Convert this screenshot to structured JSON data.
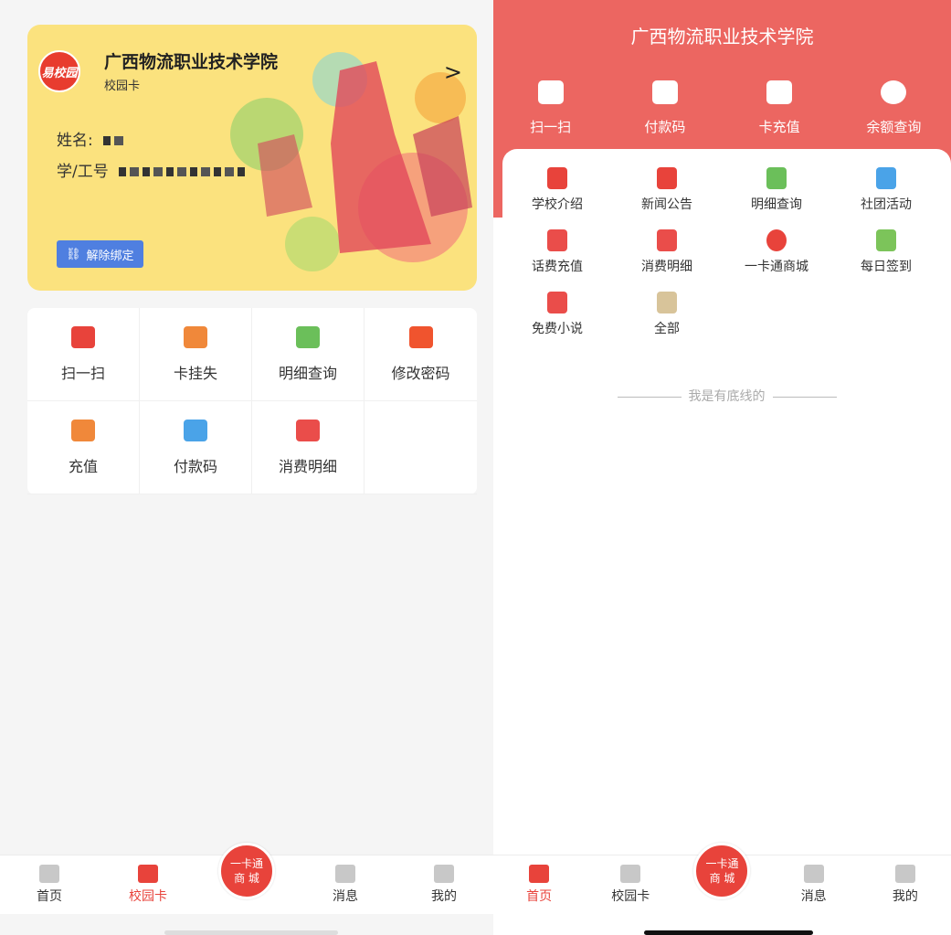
{
  "left": {
    "card": {
      "logo_text": "易校园",
      "school": "广西物流职业技术学院",
      "subtitle": "校园卡",
      "arrow": ">",
      "name_label": "姓名:",
      "id_label": "学/工号",
      "unbind_label": "解除绑定"
    },
    "grid": [
      {
        "label": "扫一扫",
        "icon": "scan-icon",
        "color": "#e8433b"
      },
      {
        "label": "卡挂失",
        "icon": "card-lost-icon",
        "color": "#f0883a"
      },
      {
        "label": "明细查询",
        "icon": "detail-query-icon",
        "color": "#6bbf5a"
      },
      {
        "label": "修改密码",
        "icon": "lock-icon",
        "color": "#f0542e"
      },
      {
        "label": "充值",
        "icon": "recharge-icon",
        "color": "#f0883a"
      },
      {
        "label": "付款码",
        "icon": "qr-code-icon",
        "color": "#4aa3e8"
      },
      {
        "label": "消费明细",
        "icon": "consumption-list-icon",
        "color": "#ea4d4a"
      }
    ],
    "nav": [
      {
        "label": "首页",
        "icon": "home-icon"
      },
      {
        "label": "校园卡",
        "icon": "card-icon"
      },
      {
        "label": "商 城",
        "top": "一卡通",
        "icon": "mall-icon"
      },
      {
        "label": "消息",
        "icon": "message-icon"
      },
      {
        "label": "我的",
        "icon": "user-icon"
      }
    ]
  },
  "right": {
    "title": "广西物流职业技术学院",
    "top": [
      {
        "label": "扫一扫",
        "icon": "scan-icon"
      },
      {
        "label": "付款码",
        "icon": "qr-code-icon"
      },
      {
        "label": "卡充值",
        "icon": "card-recharge-icon"
      },
      {
        "label": "余额查询",
        "icon": "money-bag-icon"
      }
    ],
    "grid": [
      {
        "label": "学校介绍",
        "icon": "school-icon",
        "color": "#e8433b"
      },
      {
        "label": "新闻公告",
        "icon": "news-icon",
        "color": "#e8433b"
      },
      {
        "label": "明细查询",
        "icon": "detail-query-icon",
        "color": "#6bbf5a"
      },
      {
        "label": "社团活动",
        "icon": "flag-icon",
        "color": "#4aa3e8"
      },
      {
        "label": "话费充值",
        "icon": "phone-recharge-icon",
        "color": "#ea4d4a"
      },
      {
        "label": "消费明细",
        "icon": "consumption-list-icon",
        "color": "#ea4d4a"
      },
      {
        "label": "一卡通商城",
        "icon": "heart-hand-icon",
        "color": "#e8433b"
      },
      {
        "label": "每日签到",
        "icon": "calendar-check-icon",
        "color": "#7cc45a"
      },
      {
        "label": "免费小说",
        "icon": "book-icon",
        "color": "#ea4d4a"
      },
      {
        "label": "全部",
        "icon": "all-grid-icon",
        "color": "#d8c49a"
      }
    ],
    "bottom_line": "我是有底线的",
    "nav": [
      {
        "label": "首页",
        "icon": "home-icon"
      },
      {
        "label": "校园卡",
        "icon": "card-icon"
      },
      {
        "label": "商 城",
        "top": "一卡通",
        "icon": "mall-icon"
      },
      {
        "label": "消息",
        "icon": "message-icon"
      },
      {
        "label": "我的",
        "icon": "user-icon"
      }
    ]
  },
  "colors": {
    "accent": "#e8433b",
    "header_red": "#ec6661",
    "card_yellow": "#fbe27e",
    "unbind_blue": "#4f7fe0"
  }
}
